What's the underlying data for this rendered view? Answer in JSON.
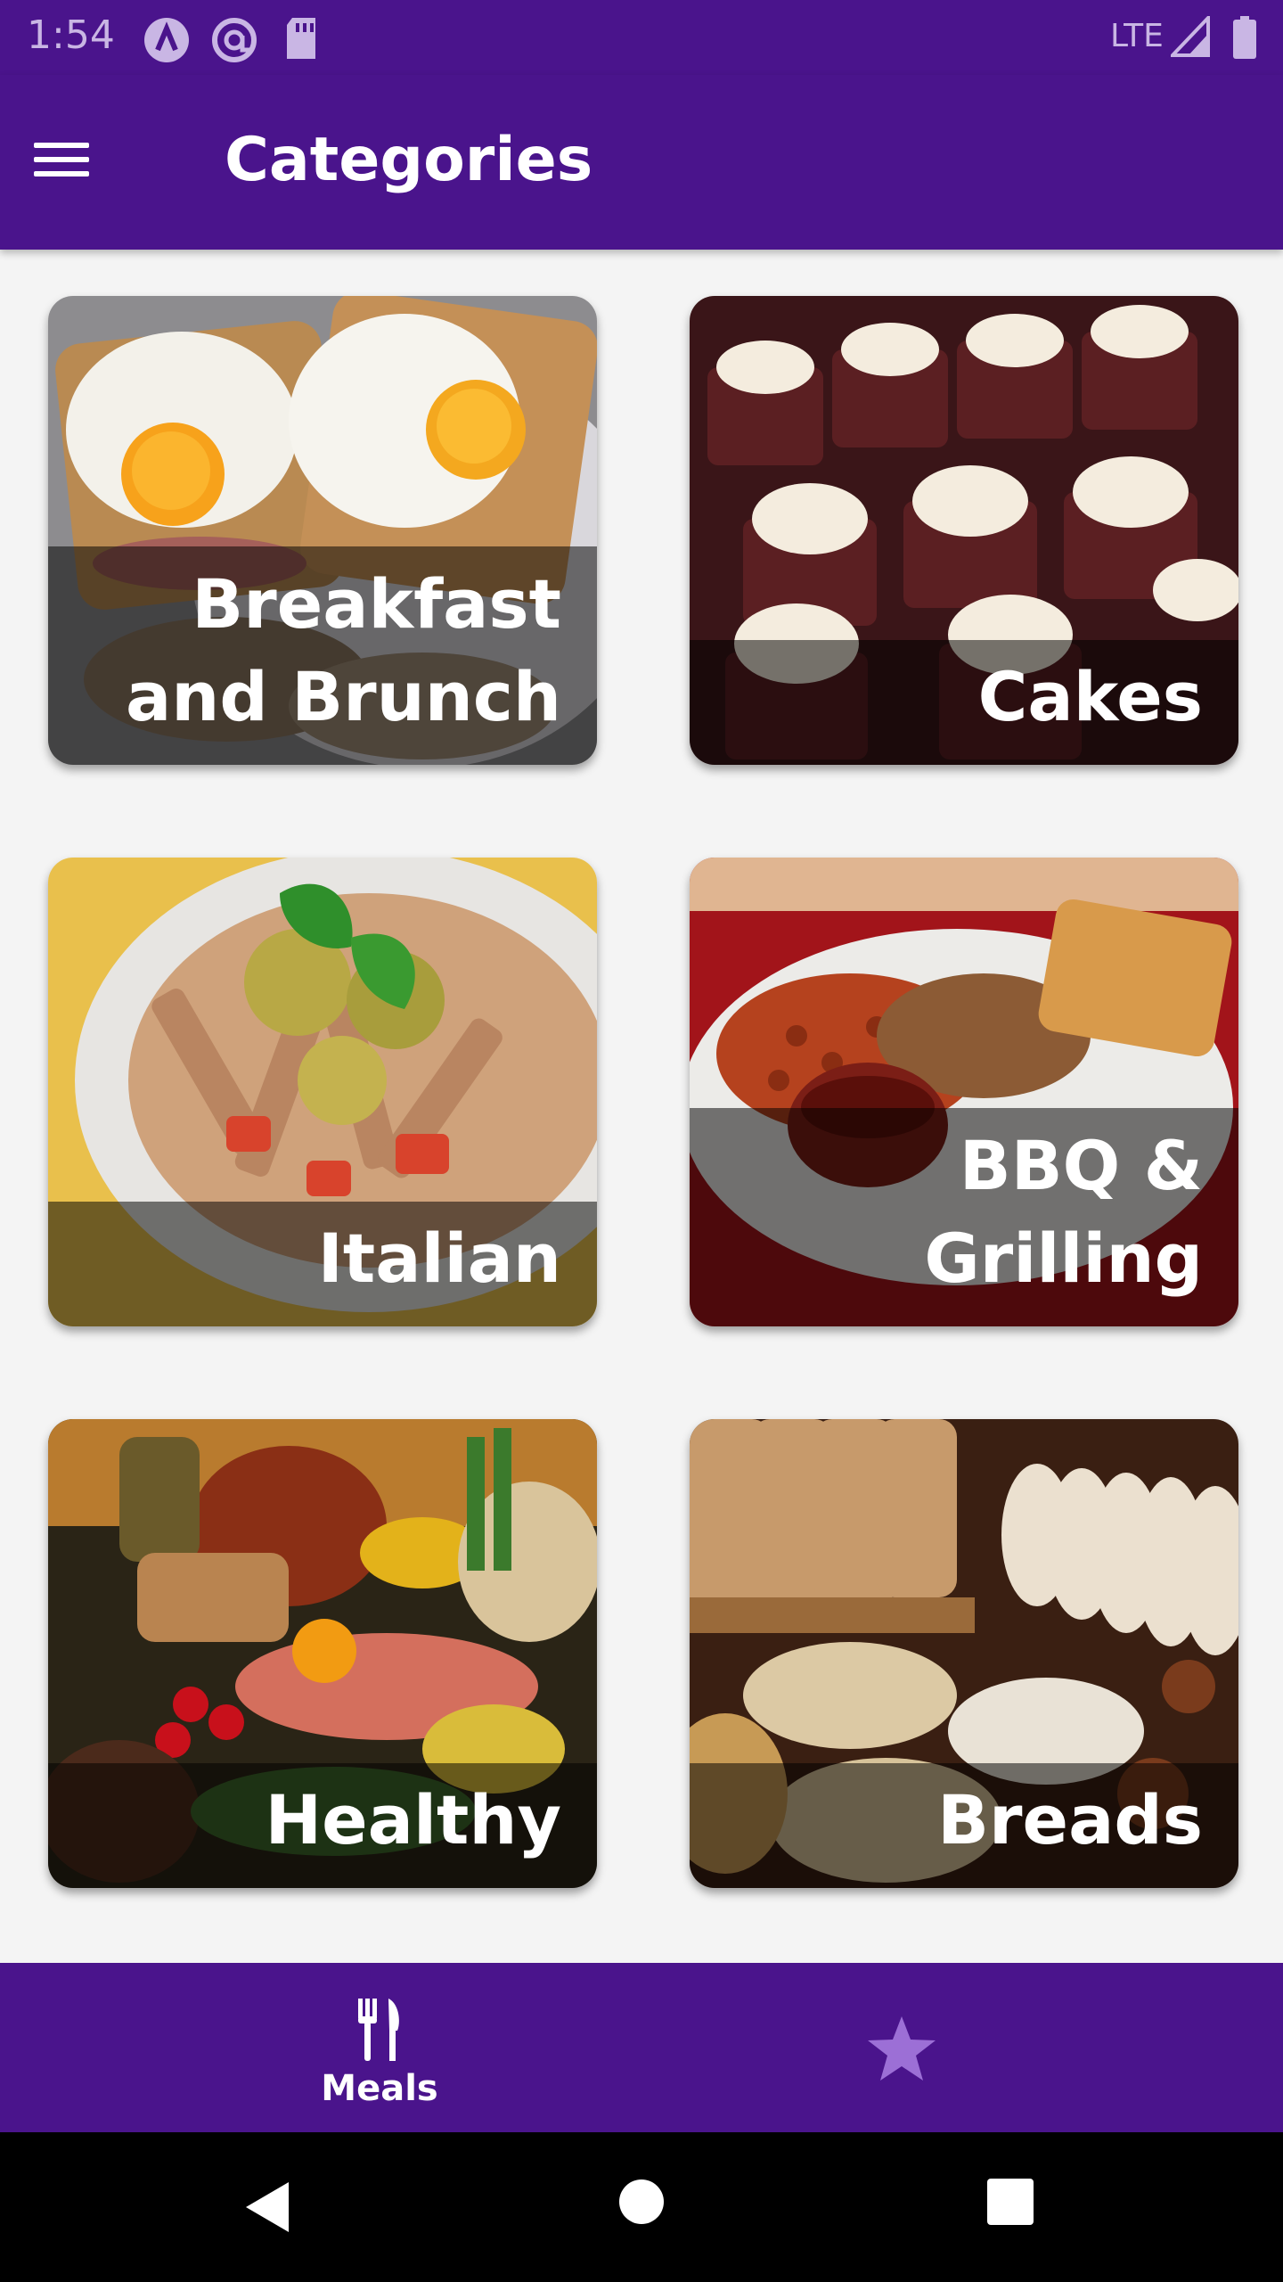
{
  "status_bar": {
    "time": "1:54",
    "network": "LTE",
    "icons": [
      "autofill-a-icon",
      "at-sign-icon",
      "sd-card-icon",
      "signal-icon",
      "battery-icon"
    ]
  },
  "app_bar": {
    "menu_icon": "hamburger-menu-icon",
    "title": "Categories"
  },
  "categories": [
    {
      "label": "Breakfast\nand Brunch",
      "image": "fried-eggs-on-toast"
    },
    {
      "label": "Cakes",
      "image": "cupcakes"
    },
    {
      "label": "Italian",
      "image": "pasta-bowl"
    },
    {
      "label": "BBQ &\nGrilling",
      "image": "bbq-plate"
    },
    {
      "label": "Healthy",
      "image": "fresh-produce"
    },
    {
      "label": "Breads",
      "image": "bread-loaves"
    }
  ],
  "bottom_nav": {
    "meals_label": "Meals",
    "meals_icon": "fork-knife-icon",
    "favorites_icon": "star-icon",
    "active_tab": "meals"
  },
  "system_nav": {
    "icons": [
      "back-icon",
      "home-icon",
      "recents-icon"
    ]
  },
  "colors": {
    "primary": "#4a148c",
    "inactive_icon": "#9c6fd6",
    "background": "#f4f4f4"
  }
}
